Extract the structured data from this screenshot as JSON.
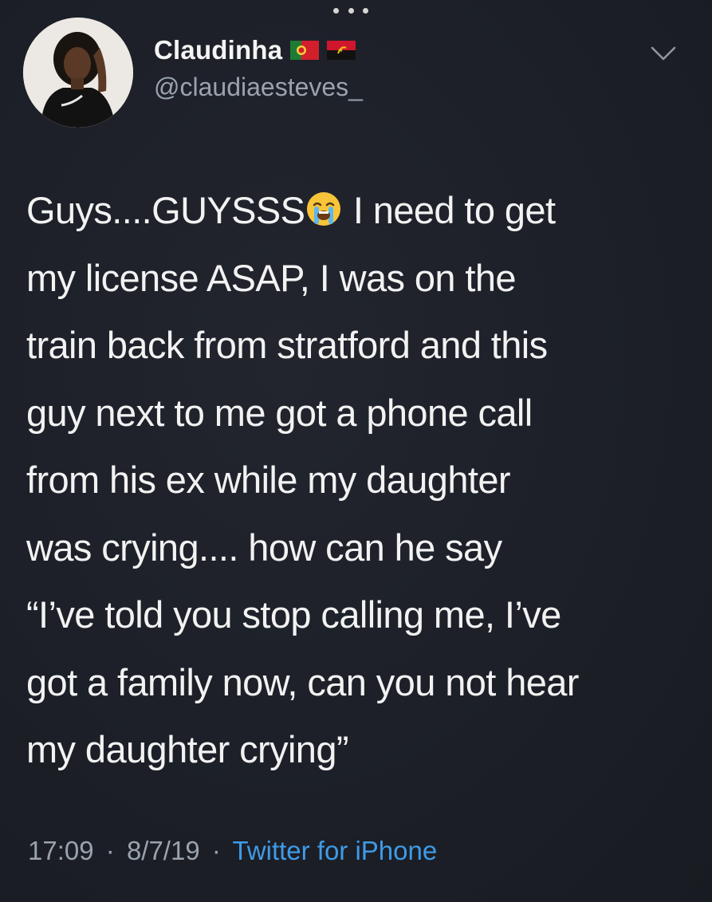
{
  "tweet": {
    "display_name": "Claudinha",
    "handle": "@claudiaesteves_",
    "flags": [
      "portugal-flag-icon",
      "angola-flag-icon"
    ],
    "text": {
      "line1_before": "Guys....GUYSSS",
      "emoji": "loudly-crying-face-icon",
      "line1_after": " I need to get",
      "rest": "my license ASAP, I was on the\ntrain back from stratford and this\nguy next to me got a phone call\nfrom his ex while my daughter\nwas crying.... how can he say\n“I’ve told you stop calling me, I’ve\ngot a family now, can you not hear\nmy daughter crying”"
    },
    "time": "17:09",
    "date": "8/7/19",
    "source": "Twitter for iPhone",
    "separator": "·"
  },
  "colors": {
    "background": "#1c1f27",
    "text": "#f2f2f2",
    "secondary": "#9aa3ad",
    "link": "#3e9be7"
  }
}
